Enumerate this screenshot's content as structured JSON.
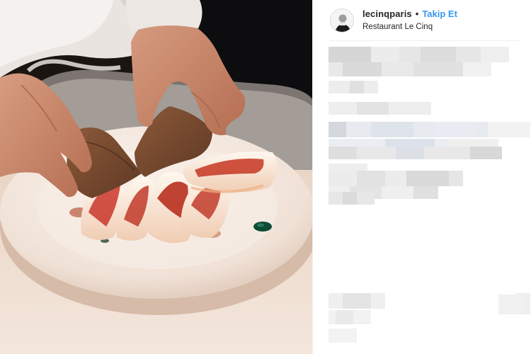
{
  "post": {
    "username": "lecinqparis",
    "separator": "•",
    "follow_label": "Takip Et",
    "location": "Restaurant Le Cinq"
  },
  "colors": {
    "follow": "#3897f0",
    "text": "#262626",
    "divider": "#efefef"
  },
  "icons": {
    "avatar": "chef-portrait-icon"
  }
}
